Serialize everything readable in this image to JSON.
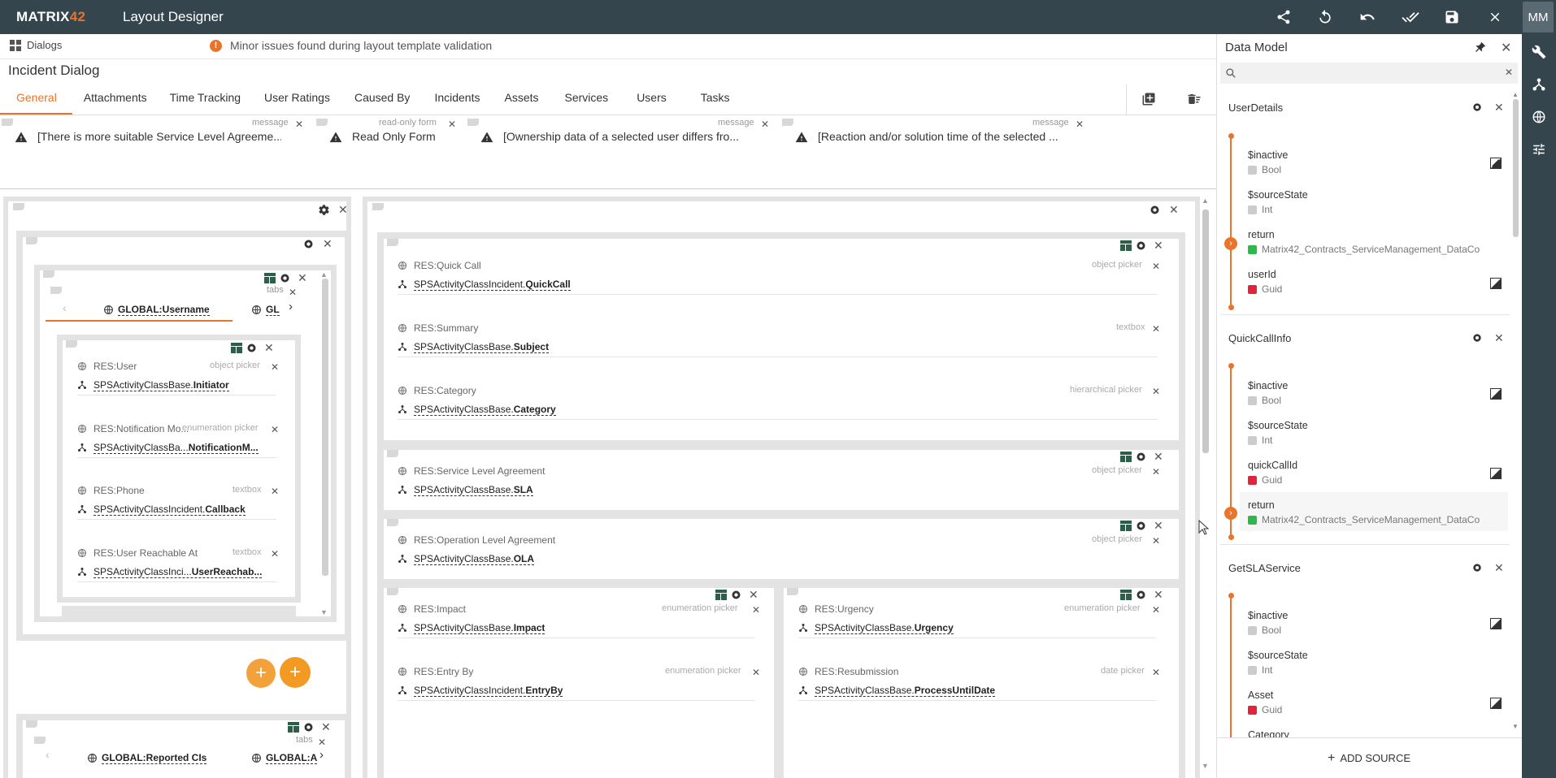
{
  "header": {
    "logo_main": "MATRIX",
    "logo_num": "42",
    "title": "Layout Designer",
    "avatar": "MM",
    "icons": [
      "share-icon",
      "refresh-icon",
      "undo-icon",
      "done-all-icon",
      "save-icon",
      "close-icon"
    ]
  },
  "breadcrumb": "Dialogs",
  "validation": {
    "message": "Minor issues found during layout template validation",
    "badge": "!"
  },
  "dialog_title": "Incident Dialog",
  "tabs": [
    "General",
    "Attachments",
    "Time Tracking",
    "User Ratings",
    "Caused By",
    "Incidents",
    "Assets",
    "Services",
    "Users",
    "Tasks"
  ],
  "messages": [
    {
      "tag": "message",
      "text": "[There is more suitable Service Level Agreeme..."
    },
    {
      "tag": "read-only form",
      "text": "Read Only Form"
    },
    {
      "tag": "message",
      "text": "[Ownership data of a selected user differs fro..."
    },
    {
      "tag": "message",
      "text": "[Reaction and/or solution time of the selected ..."
    }
  ],
  "left_tabs": {
    "tag": "tabs",
    "tab1": "GLOBAL:Username",
    "tab2": "GL"
  },
  "left_fields": [
    {
      "label": "RES:User",
      "type": "object picker",
      "bind_prefix": "SPSActivityClassBase.",
      "bind_field": "Initiator"
    },
    {
      "label": "RES:Notification Mo...",
      "type": "enumeration picker",
      "bind_prefix": "SPSActivityClassBa...",
      "bind_field": "NotificationM..."
    },
    {
      "label": "RES:Phone",
      "type": "textbox",
      "bind_prefix": "SPSActivityClassIncident.",
      "bind_field": "Callback"
    },
    {
      "label": "RES:User Reachable At",
      "type": "textbox",
      "bind_prefix": "SPSActivityClassInci...",
      "bind_field": "UserReachab..."
    }
  ],
  "bottom_tabs": {
    "tag": "tabs",
    "tab1": "GLOBAL:Reported CIs",
    "tab2": "GLOBAL:A"
  },
  "fab_label": "+",
  "main_fields": [
    {
      "label": "RES:Quick Call",
      "type": "object picker",
      "bind_prefix": "SPSActivityClassIncident.",
      "bind_field": "QuickCall"
    },
    {
      "label": "RES:Summary",
      "type": "textbox",
      "bind_prefix": "SPSActivityClassBase.",
      "bind_field": "Subject"
    },
    {
      "label": "RES:Category",
      "type": "hierarchical picker",
      "bind_prefix": "SPSActivityClassBase.",
      "bind_field": "Category"
    },
    {
      "label": "RES:Service Level Agreement",
      "type": "object picker",
      "bind_prefix": "SPSActivityClassBase.",
      "bind_field": "SLA"
    },
    {
      "label": "RES:Operation Level Agreement",
      "type": "object picker",
      "bind_prefix": "SPSActivityClassBase.",
      "bind_field": "OLA"
    },
    {
      "label": "RES:Impact",
      "type": "enumeration picker",
      "bind_prefix": "SPSActivityClassBase.",
      "bind_field": "Impact"
    },
    {
      "label": "RES:Entry By",
      "type": "enumeration picker",
      "bind_prefix": "SPSActivityClassIncident.",
      "bind_field": "EntryBy"
    },
    {
      "label": "RES:Urgency",
      "type": "enumeration picker",
      "bind_prefix": "SPSActivityClassBase.",
      "bind_field": "Urgency"
    },
    {
      "label": "RES:Resubmission",
      "type": "date picker",
      "bind_prefix": "SPSActivityClassBase.",
      "bind_field": "ProcessUntilDate"
    }
  ],
  "data_model": {
    "title": "Data Model",
    "add_source": "ADD SOURCE",
    "sections": [
      {
        "name": "UserDetails",
        "items": [
          {
            "name": "$inactive",
            "type": "Bool",
            "color": "#cccccc",
            "edit": true
          },
          {
            "name": "$sourceState",
            "type": "Int",
            "color": "#cccccc",
            "edit": false
          },
          {
            "name": "return",
            "type": "Matrix42_Contracts_ServiceManagement_DataCo",
            "color": "#2db84b",
            "edit": false,
            "expand": true
          },
          {
            "name": "userId",
            "type": "Guid",
            "color": "#e0243b",
            "edit": true
          }
        ]
      },
      {
        "name": "QuickCallInfo",
        "items": [
          {
            "name": "$inactive",
            "type": "Bool",
            "color": "#cccccc",
            "edit": true
          },
          {
            "name": "$sourceState",
            "type": "Int",
            "color": "#cccccc",
            "edit": false
          },
          {
            "name": "quickCallId",
            "type": "Guid",
            "color": "#e0243b",
            "edit": true
          },
          {
            "name": "return",
            "type": "Matrix42_Contracts_ServiceManagement_DataCo",
            "color": "#2db84b",
            "edit": false,
            "expand": true
          }
        ]
      },
      {
        "name": "GetSLAService",
        "items": [
          {
            "name": "$inactive",
            "type": "Bool",
            "color": "#cccccc",
            "edit": true
          },
          {
            "name": "$sourceState",
            "type": "Int",
            "color": "#cccccc",
            "edit": false
          },
          {
            "name": "Asset",
            "type": "Guid",
            "color": "#e0243b",
            "edit": true
          },
          {
            "name": "Category",
            "type": "",
            "color": "#cccccc",
            "edit": false
          }
        ]
      }
    ]
  }
}
